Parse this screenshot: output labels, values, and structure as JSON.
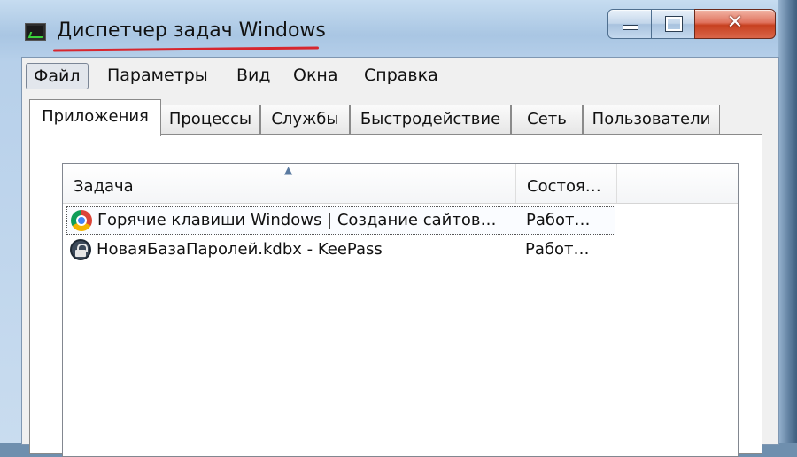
{
  "window": {
    "title": "Диспетчер задач Windows",
    "close_glyph": "✕"
  },
  "menu": {
    "items": [
      "Файл",
      "Параметры",
      "Вид",
      "Окна",
      "Справка"
    ]
  },
  "tabs": {
    "items": [
      "Приложения",
      "Процессы",
      "Службы",
      "Быстродействие",
      "Сеть",
      "Пользователи"
    ],
    "selected": "Приложения"
  },
  "list": {
    "sort_arrow": "▲",
    "columns": [
      "Задача",
      "Состоя…"
    ],
    "rows": [
      {
        "task": "Горячие клавиши Windows | Создание сайтов…",
        "status": "Работ…",
        "icon": "chrome-icon"
      },
      {
        "task": "НоваяБазаПаролей.kdbx - KeePass",
        "status": "Работ…",
        "icon": "keepass-icon"
      }
    ]
  },
  "colors": {
    "accent_underline": "#d7262e",
    "close_button": "#c7401f"
  }
}
